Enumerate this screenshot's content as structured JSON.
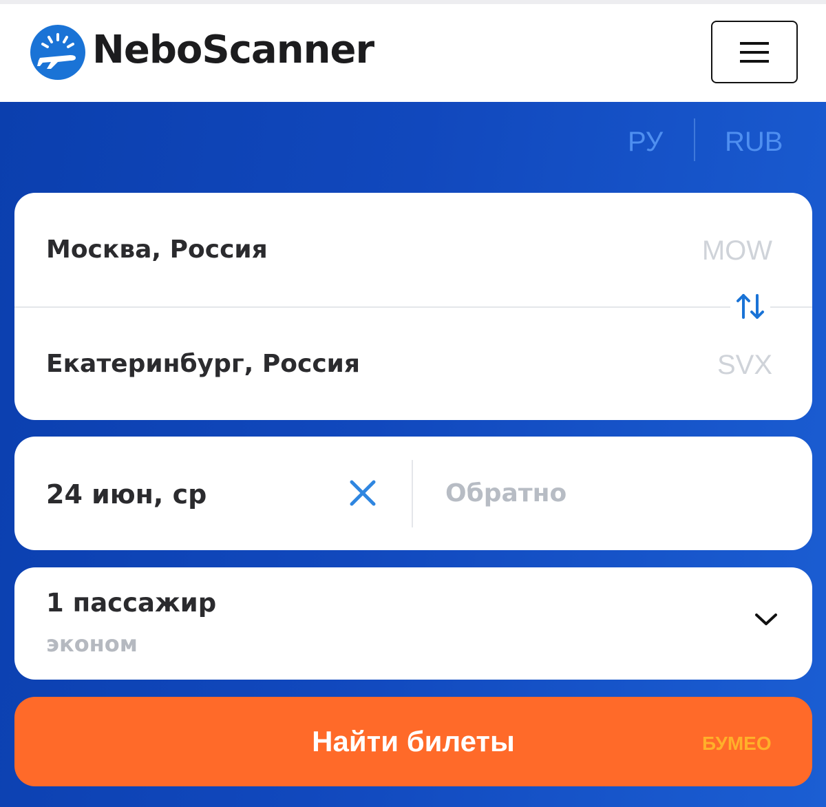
{
  "header": {
    "brand": "NeboScanner",
    "logo_icon": "airplane-sun-icon",
    "menu_icon": "hamburger-menu-icon"
  },
  "settings": {
    "language": "РУ",
    "currency": "RUB"
  },
  "route": {
    "from_city": "Москва, Россия",
    "from_code": "MOW",
    "to_city": "Екатеринбург, Россия",
    "to_code": "SVX",
    "swap_icon": "swap-arrows-icon"
  },
  "dates": {
    "depart": "24 июн, ср",
    "clear_icon": "close-icon",
    "return_placeholder": "Обратно"
  },
  "passengers": {
    "count_label": "1 пассажир",
    "class_label": "эконом",
    "dropdown_icon": "chevron-down-icon"
  },
  "search": {
    "label": "Найти билеты"
  },
  "watermark": "БУМЕО",
  "colors": {
    "brand_blue": "#1148bd",
    "accent_orange": "#ff6a29",
    "link_blue": "#4f8ff0"
  }
}
